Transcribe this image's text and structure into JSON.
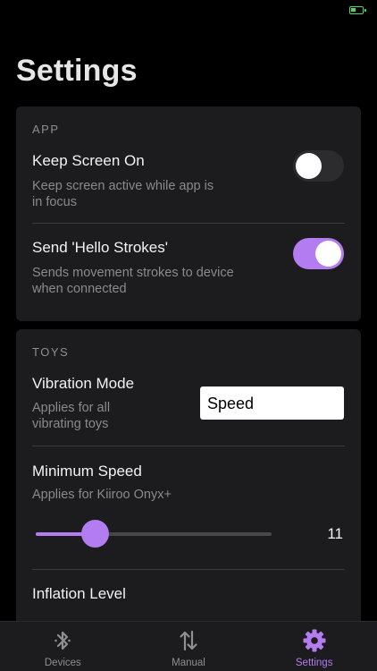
{
  "title": "Settings",
  "colors": {
    "accent": "#b37cf0",
    "card": "#1c1c1e",
    "battery": "#4cd964"
  },
  "app_section": {
    "header": "APP",
    "keep_screen_on": {
      "title": "Keep Screen On",
      "desc_line1": "Keep screen active while app is",
      "desc_line2": "in focus",
      "enabled": false
    },
    "hello_strokes": {
      "title": "Send 'Hello Strokes'",
      "desc_line1": "Sends movement strokes to device",
      "desc_line2": "when connected",
      "enabled": true
    }
  },
  "toys_section": {
    "header": "TOYS",
    "vibration_mode": {
      "title": "Vibration Mode",
      "desc_line1": "Applies for all",
      "desc_line2": "vibrating toys",
      "selected": "Speed"
    },
    "minimum_speed": {
      "title": "Minimum Speed",
      "desc": "Applies for Kiiroo Onyx+",
      "value": 11,
      "value_label": "11",
      "slider_fraction": 0.25
    },
    "inflation_level": {
      "title": "Inflation Level"
    }
  },
  "tab_bar": {
    "tabs": [
      {
        "label": "Devices",
        "icon": "bluetooth-icon",
        "active": false
      },
      {
        "label": "Manual",
        "icon": "up-down-arrows-icon",
        "active": false
      },
      {
        "label": "Settings",
        "icon": "gear-icon",
        "active": true
      }
    ]
  }
}
